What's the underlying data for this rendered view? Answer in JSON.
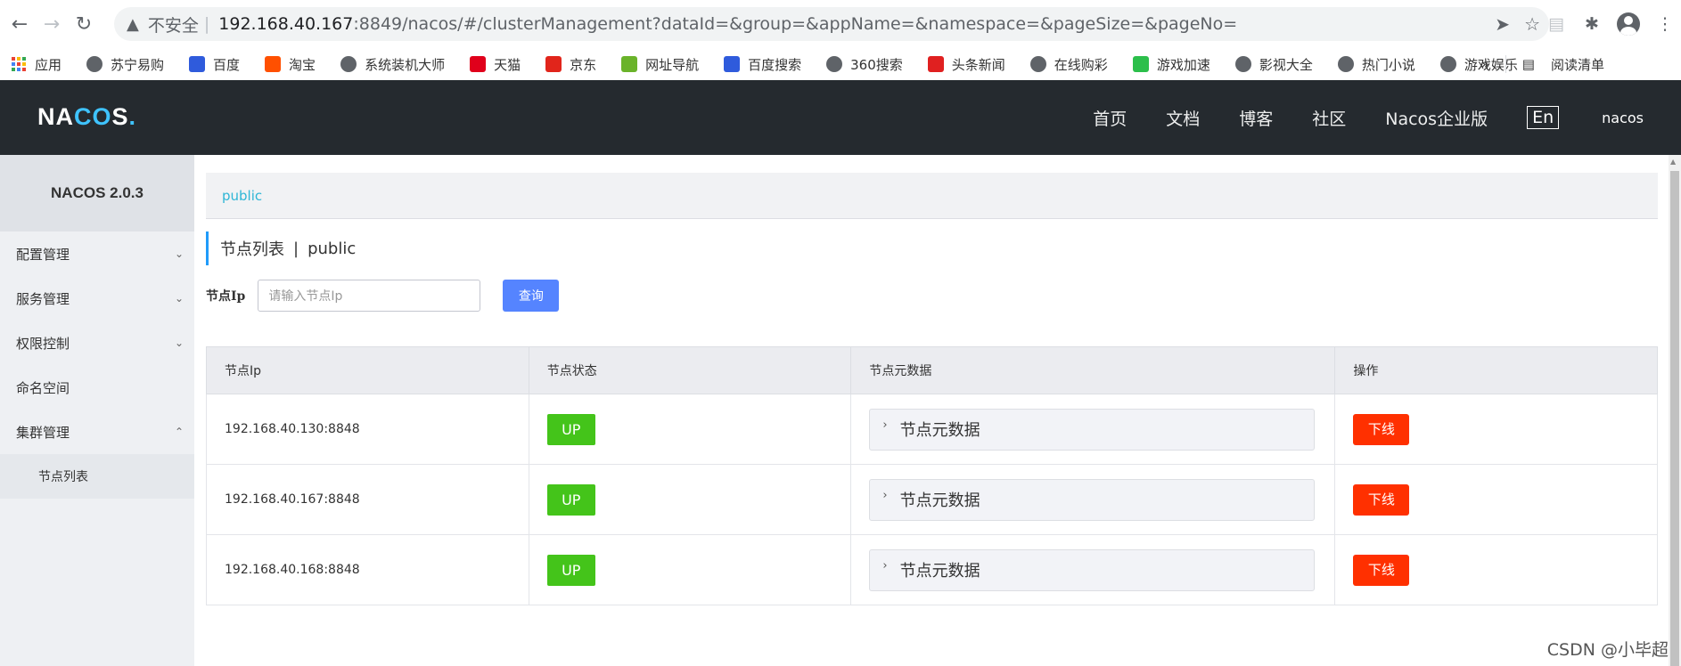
{
  "browser": {
    "insecure_label": "不安全",
    "url_host": "192.168.40.167",
    "url_rest": ":8849/nacos/#/clusterManagement?dataId=&group=&appName=&namespace=&pageSize=&pageNo=",
    "bookmarks": [
      {
        "label": "应用",
        "icon": "apps-grid"
      },
      {
        "label": "苏宁易购",
        "icon": "globe"
      },
      {
        "label": "百度",
        "icon": "baidu-paw",
        "color": "#2f5bdc"
      },
      {
        "label": "淘宝",
        "icon": "taobao",
        "color": "#ff5000"
      },
      {
        "label": "系统装机大师",
        "icon": "globe"
      },
      {
        "label": "天猫",
        "icon": "tmall",
        "color": "#e0001b"
      },
      {
        "label": "京东",
        "icon": "jd",
        "color": "#e1251b"
      },
      {
        "label": "网址导航",
        "icon": "hao123",
        "color": "#6ab32a"
      },
      {
        "label": "百度搜索",
        "icon": "baidu-paw",
        "color": "#2f5bdc"
      },
      {
        "label": "360搜索",
        "icon": "globe"
      },
      {
        "label": "头条新闻",
        "icon": "dongfang",
        "color": "#e02020"
      },
      {
        "label": "在线购彩",
        "icon": "globe"
      },
      {
        "label": "游戏加速",
        "icon": "game",
        "color": "#2cbf4b"
      },
      {
        "label": "影视大全",
        "icon": "globe"
      },
      {
        "label": "热门小说",
        "icon": "globe"
      },
      {
        "label": "游戏娱乐",
        "icon": "globe"
      }
    ],
    "more": "»",
    "reading_list": "阅读清单"
  },
  "header": {
    "logo": "NACOS.",
    "menu": [
      "首页",
      "文档",
      "博客",
      "社区",
      "Nacos企业版"
    ],
    "lang": "En",
    "user": "nacos"
  },
  "sidebar": {
    "title": "NACOS 2.0.3",
    "items": [
      {
        "label": "配置管理",
        "chevron": "down"
      },
      {
        "label": "服务管理",
        "chevron": "down"
      },
      {
        "label": "权限控制",
        "chevron": "down"
      },
      {
        "label": "命名空间",
        "chevron": ""
      },
      {
        "label": "集群管理",
        "chevron": "up"
      }
    ],
    "subitem": "节点列表"
  },
  "main": {
    "breadcrumb": "public",
    "title": "节点列表",
    "title_sep": "|",
    "title_namespace": "public",
    "filter_label": "节点Ip",
    "filter_placeholder": "请输入节点Ip",
    "query_button": "查询",
    "columns": [
      "节点Ip",
      "节点状态",
      "节点元数据",
      "操作"
    ],
    "rows": [
      {
        "ip": "192.168.40.130:8848",
        "status": "UP",
        "meta": "节点元数据",
        "action": "下线"
      },
      {
        "ip": "192.168.40.167:8848",
        "status": "UP",
        "meta": "节点元数据",
        "action": "下线"
      },
      {
        "ip": "192.168.40.168:8848",
        "status": "UP",
        "meta": "节点元数据",
        "action": "下线"
      }
    ]
  },
  "watermark": "CSDN @小毕超",
  "colors": {
    "accent": "#5584ff",
    "status_up": "#44c41a",
    "offline": "#ff3000",
    "header_bg": "#252a2f",
    "link": "#2eb6d6"
  }
}
